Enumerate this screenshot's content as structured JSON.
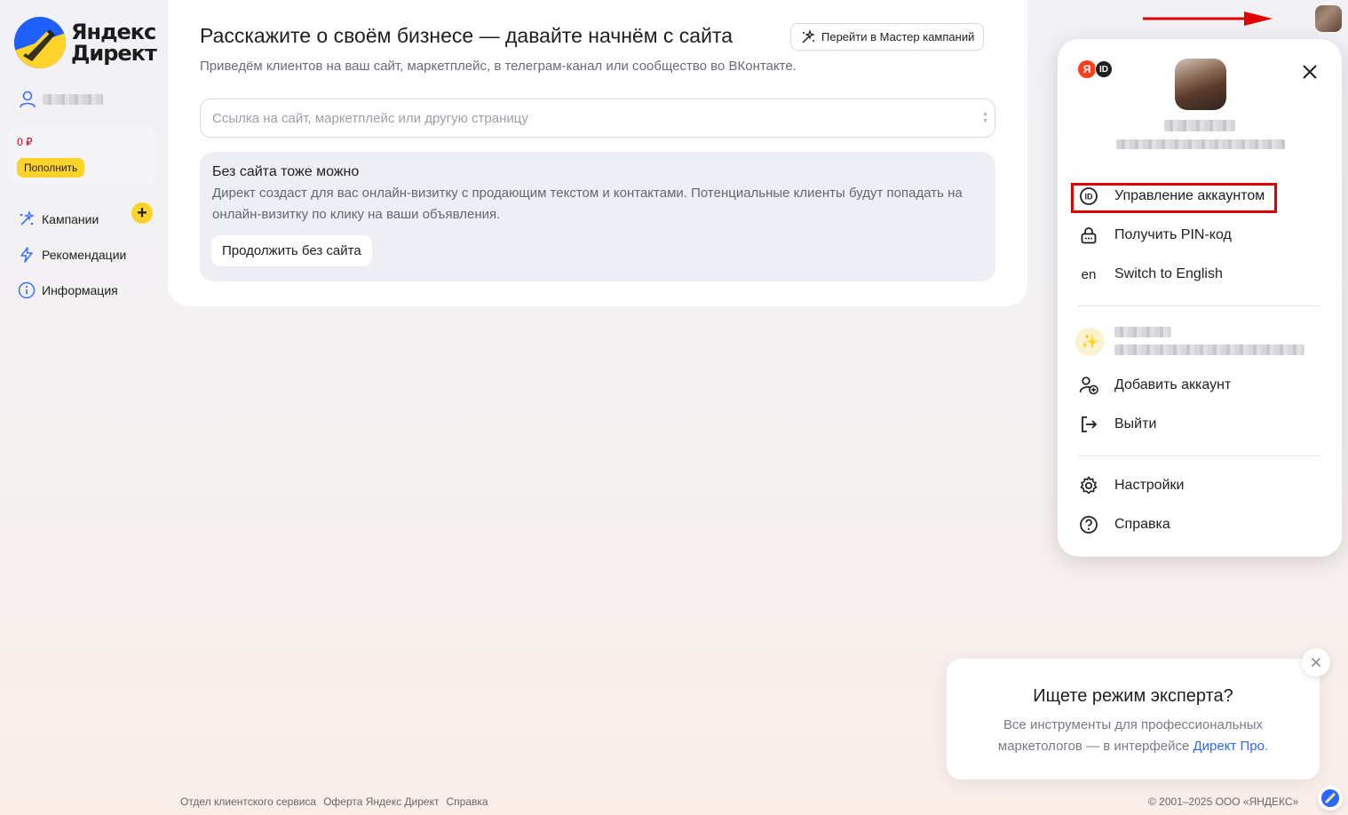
{
  "sidebar": {
    "logo_line1": "Яндекс",
    "logo_line2": "Директ",
    "balance": "0 ₽",
    "topup_label": "Пополнить",
    "nav": [
      {
        "label": "Кампании",
        "icon": "campaigns-icon"
      },
      {
        "label": "Рекомендации",
        "icon": "lightning-icon"
      },
      {
        "label": "Информация",
        "icon": "info-icon"
      }
    ]
  },
  "main": {
    "title": "Расскажите о своём бизнесе — давайте начнём с сайта",
    "subtitle": "Приведём клиентов на ваш сайт, маркетплейс, в телеграм-канал или сообщество во ВКонтакте.",
    "master_button": "Перейти в Мастер кампаний",
    "url_input": {
      "value": "",
      "placeholder": "Ссылка на сайт, маркетплейс или другую страницу"
    },
    "nosite": {
      "title": "Без сайта тоже можно",
      "text": "Директ создаст для вас онлайн-визитку с продающим текстом и контактами. Потенциальные клиенты будут попадать на онлайн-визитку по клику на ваши объявления.",
      "button": "Продолжить без сайта"
    }
  },
  "account_popup": {
    "badge_ya": "Я",
    "badge_id": "ID",
    "items": [
      {
        "label": "Управление аккаунтом",
        "icon": "id-icon",
        "highlighted": true
      },
      {
        "label": "Получить PIN-код",
        "icon": "lock-icon"
      },
      {
        "label": "Switch to English",
        "icon_text": "en"
      }
    ],
    "other_items": [
      {
        "label": "Добавить аккаунт",
        "icon": "add-user-icon"
      },
      {
        "label": "Выйти",
        "icon": "logout-icon"
      }
    ],
    "bottom_items": [
      {
        "label": "Настройки",
        "icon": "gear-icon"
      },
      {
        "label": "Справка",
        "icon": "help-icon"
      }
    ],
    "highlight_color": "#e00000"
  },
  "expert_popup": {
    "title": "Ищете режим эксперта?",
    "text_before_link": "Все инструменты для профессиональных маркетологов — в интерфейсе ",
    "link": "Директ Про",
    "text_after_link": "."
  },
  "footer": {
    "links": [
      "Отдел клиентского сервиса",
      "Оферта Яндекс Директ",
      "Справка"
    ],
    "copyright": "© 2001–2025 ООО «ЯНДЕКС»"
  },
  "colors": {
    "accent_yellow": "#fed42b",
    "brand_blue": "#1f5eff",
    "link_blue": "#2b66ff",
    "arrow_red": "#e00000"
  }
}
